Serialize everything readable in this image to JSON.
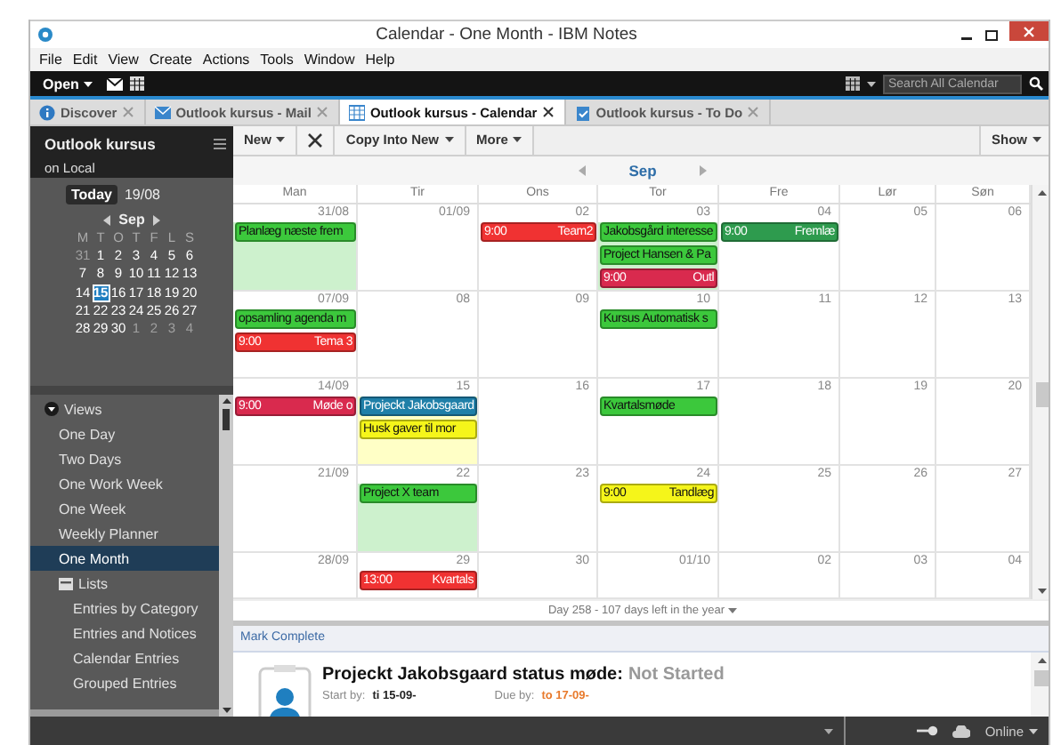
{
  "window": {
    "title": "Calendar - One Month - IBM Notes"
  },
  "menu": [
    "File",
    "Edit",
    "View",
    "Create",
    "Actions",
    "Tools",
    "Window",
    "Help"
  ],
  "toolbar": {
    "open": "Open",
    "search": {
      "placeholder": "Search All Calendar"
    }
  },
  "tabs": [
    {
      "label": "Discover",
      "kind": "info",
      "selected": false
    },
    {
      "label": "Outlook kursus - Mail",
      "kind": "mail",
      "selected": false
    },
    {
      "label": "Outlook kursus - Calendar",
      "kind": "calendar",
      "selected": true
    },
    {
      "label": "Outlook kursus - To Do",
      "kind": "todo",
      "selected": false
    }
  ],
  "sidebar": {
    "title": "Outlook kursus",
    "subtitle": "on Local",
    "today": "Today",
    "today_date": "19/08",
    "month": "Sep",
    "weekdays": [
      "M",
      "T",
      "O",
      "T",
      "F",
      "L",
      "S"
    ],
    "weeks": [
      [
        {
          "day": "31",
          "muted": true,
          "selected": false
        },
        {
          "day": "1",
          "muted": false,
          "selected": false
        },
        {
          "day": "2",
          "muted": false,
          "selected": false
        },
        {
          "day": "3",
          "muted": false,
          "selected": false
        },
        {
          "day": "4",
          "muted": false,
          "selected": false
        },
        {
          "day": "5",
          "muted": false,
          "selected": false
        },
        {
          "day": "6",
          "muted": false,
          "selected": false
        }
      ],
      [
        {
          "day": "7",
          "muted": false,
          "selected": false
        },
        {
          "day": "8",
          "muted": false,
          "selected": false
        },
        {
          "day": "9",
          "muted": false,
          "selected": false
        },
        {
          "day": "10",
          "muted": false,
          "selected": false
        },
        {
          "day": "11",
          "muted": false,
          "selected": false
        },
        {
          "day": "12",
          "muted": false,
          "selected": false
        },
        {
          "day": "13",
          "muted": false,
          "selected": false
        }
      ],
      [
        {
          "day": "14",
          "muted": false,
          "selected": false
        },
        {
          "day": "15",
          "muted": false,
          "selected": true
        },
        {
          "day": "16",
          "muted": false,
          "selected": false
        },
        {
          "day": "17",
          "muted": false,
          "selected": false
        },
        {
          "day": "18",
          "muted": false,
          "selected": false
        },
        {
          "day": "19",
          "muted": false,
          "selected": false
        },
        {
          "day": "20",
          "muted": false,
          "selected": false
        }
      ],
      [
        {
          "day": "21",
          "muted": false,
          "selected": false
        },
        {
          "day": "22",
          "muted": false,
          "selected": false
        },
        {
          "day": "23",
          "muted": false,
          "selected": false
        },
        {
          "day": "24",
          "muted": false,
          "selected": false
        },
        {
          "day": "25",
          "muted": false,
          "selected": false
        },
        {
          "day": "26",
          "muted": false,
          "selected": false
        },
        {
          "day": "27",
          "muted": false,
          "selected": false
        }
      ],
      [
        {
          "day": "28",
          "muted": false,
          "selected": false
        },
        {
          "day": "29",
          "muted": false,
          "selected": false
        },
        {
          "day": "30",
          "muted": false,
          "selected": false
        },
        {
          "day": "1",
          "muted": true,
          "selected": false
        },
        {
          "day": "2",
          "muted": true,
          "selected": false
        },
        {
          "day": "3",
          "muted": true,
          "selected": false
        },
        {
          "day": "4",
          "muted": true,
          "selected": false
        }
      ]
    ],
    "views": {
      "label": "Views",
      "expanded": true,
      "children": [
        {
          "label": "One Day",
          "selected": false
        },
        {
          "label": "Two Days",
          "selected": false
        },
        {
          "label": "One Work Week",
          "selected": false
        },
        {
          "label": "One Week",
          "selected": false
        },
        {
          "label": "Weekly Planner",
          "selected": false
        },
        {
          "label": "One Month",
          "selected": true
        },
        {
          "label": "Lists",
          "kind": "folder",
          "expanded": true,
          "selected": false,
          "children": [
            {
              "label": "Entries by Category",
              "selected": false
            },
            {
              "label": "Entries and Notices",
              "selected": false
            },
            {
              "label": "Calendar Entries",
              "selected": false
            },
            {
              "label": "Grouped Entries",
              "selected": false
            }
          ]
        }
      ]
    }
  },
  "calendar_toolbar": {
    "buttons": [
      {
        "kind": "dropdown",
        "label": "New"
      },
      {
        "kind": "delete"
      },
      {
        "kind": "dropdown",
        "label": "Copy Into New"
      },
      {
        "kind": "dropdown",
        "label": "More"
      }
    ],
    "show": "Show"
  },
  "calendar": {
    "month": "Sep",
    "days": [
      "Man",
      "Tir",
      "Ons",
      "Tor",
      "Fre",
      "Lør",
      "Søn"
    ],
    "weeks": [
      [
        {
          "date": "31/08",
          "color": "#cdf1cd",
          "events": [
            {
              "title": "Planlæg næste frem",
              "color": "#3cc83c"
            }
          ]
        },
        {
          "date": "01/09"
        },
        {
          "date": "02",
          "events": [
            {
              "time": "9:00",
              "title": "Team2",
              "color": "#f03232"
            }
          ]
        },
        {
          "date": "03",
          "color": "#cdf1cd",
          "events": [
            {
              "title": "Jakobsgård interesse",
              "color": "#3cc83c"
            },
            {
              "title": "Project Hansen & Pa",
              "color": "#3cc83c"
            },
            {
              "time": "9:00",
              "title": "Outl",
              "color": "#d92a4e"
            }
          ]
        },
        {
          "date": "04",
          "events": [
            {
              "time": "9:00",
              "title": "Fremlæ",
              "color": "#2e9b4e"
            }
          ]
        },
        {
          "date": "05"
        },
        {
          "date": "06"
        }
      ],
      [
        {
          "date": "07/09",
          "events": [
            {
              "title": "opsamling agenda m",
              "color": "#3cc83c"
            },
            {
              "time": "9:00",
              "title": "Tema 3",
              "color": "#f03232"
            }
          ]
        },
        {
          "date": "08"
        },
        {
          "date": "09"
        },
        {
          "date": "10",
          "events": [
            {
              "title": "Kursus Automatisk s",
              "color": "#3cc83c"
            }
          ]
        },
        {
          "date": "11"
        },
        {
          "date": "12"
        },
        {
          "date": "13"
        }
      ],
      [
        {
          "date": "14/09",
          "events": [
            {
              "time": "9:00",
              "title": "Møde o",
              "color": "#d92a4e"
            }
          ]
        },
        {
          "date": "15",
          "color": "#ffffc6",
          "events": [
            {
              "title": "Projeckt Jakobsgaard",
              "color": "#1f7fa8"
            },
            {
              "title": "Husk gaver til mor",
              "color": "#f5f51a"
            }
          ]
        },
        {
          "date": "16"
        },
        {
          "date": "17",
          "events": [
            {
              "title": "Kvartalsmøde",
              "color": "#3cc83c"
            }
          ]
        },
        {
          "date": "18"
        },
        {
          "date": "19"
        },
        {
          "date": "20"
        }
      ],
      [
        {
          "date": "21/09"
        },
        {
          "date": "22",
          "color": "#cdf1cd",
          "events": [
            {
              "title": "Project X team",
              "color": "#3cc83c"
            }
          ]
        },
        {
          "date": "23"
        },
        {
          "date": "24",
          "events": [
            {
              "time": "9:00",
              "title": "Tandlæg",
              "color": "#f5f51a"
            }
          ]
        },
        {
          "date": "25"
        },
        {
          "date": "26"
        },
        {
          "date": "27"
        }
      ],
      [
        {
          "date": "28/09"
        },
        {
          "date": "29",
          "events": [
            {
              "time": "13:00",
              "title": "Kvartals",
              "color": "#f03232"
            }
          ]
        },
        {
          "date": "30"
        },
        {
          "date": "01/10"
        },
        {
          "date": "02"
        },
        {
          "date": "03"
        },
        {
          "date": "04"
        }
      ]
    ],
    "footer": "Day 258 - 107 days left in the year"
  },
  "preview": {
    "action": "Mark Complete",
    "title": "Projeckt Jakobsgaard status møde:",
    "status": "Not Started",
    "start_label": "Start by:",
    "start": "ti 15-09-",
    "due_label": "Due by:",
    "due": "to 17-09-"
  },
  "status_bar": {
    "online": "Online"
  }
}
